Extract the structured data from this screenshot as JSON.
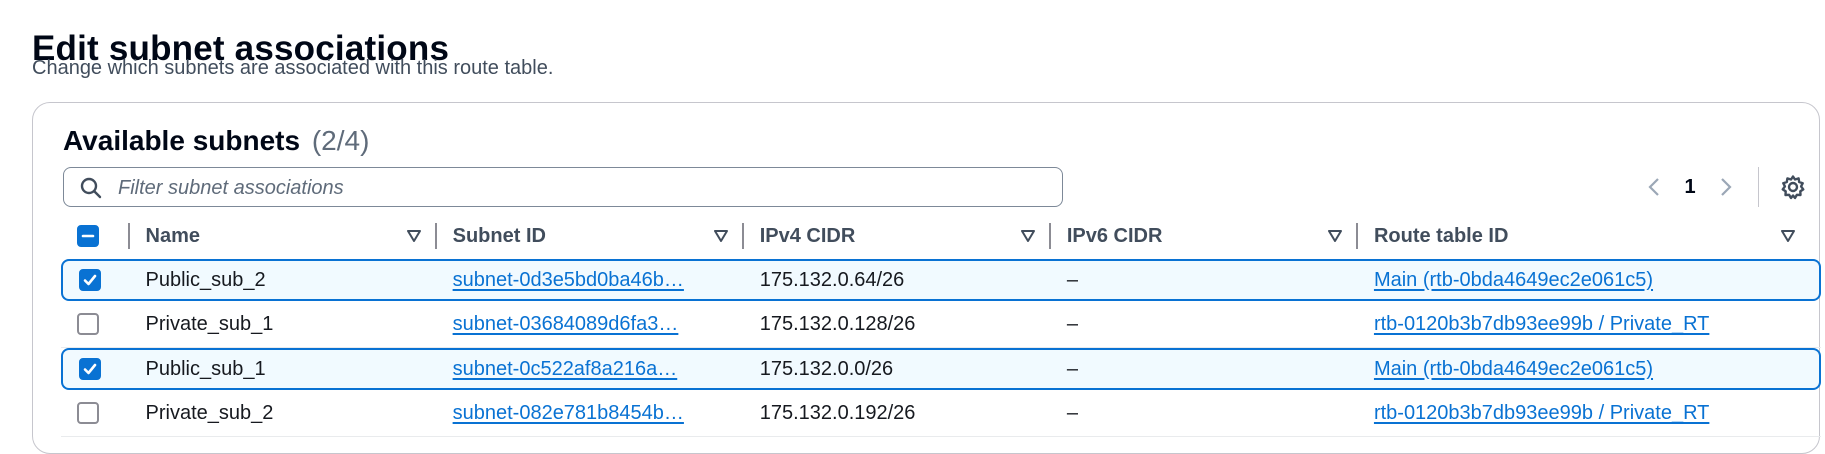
{
  "page": {
    "title": "Edit subnet associations",
    "description": "Change which subnets are associated with this route table."
  },
  "card": {
    "title": "Available subnets",
    "count": "(2/4)"
  },
  "filter": {
    "placeholder": "Filter subnet associations",
    "value": ""
  },
  "pagination": {
    "current_page": "1"
  },
  "icons": {
    "search": "search-icon",
    "prev": "chevron-left-icon",
    "next": "chevron-right-icon",
    "settings": "gear-icon",
    "sort": "caret-down-outline-icon"
  },
  "colors": {
    "link": "#0972d3",
    "selected_bg": "#f1faff",
    "checkbox": "#0972d3"
  },
  "table": {
    "select_all_state": "indeterminate",
    "columns": [
      "Name",
      "Subnet ID",
      "IPv4 CIDR",
      "IPv6 CIDR",
      "Route table ID"
    ],
    "rows": [
      {
        "selected": true,
        "name": "Public_sub_2",
        "subnet_id": "subnet-0d3e5bd0ba46b…",
        "ipv4": "175.132.0.64/26",
        "ipv6": "–",
        "route_table": "Main (rtb-0bda4649ec2e061c5)"
      },
      {
        "selected": false,
        "name": "Private_sub_1",
        "subnet_id": "subnet-03684089d6fa3…",
        "ipv4": "175.132.0.128/26",
        "ipv6": "–",
        "route_table": "rtb-0120b3b7db93ee99b / Private_RT"
      },
      {
        "selected": true,
        "name": "Public_sub_1",
        "subnet_id": "subnet-0c522af8a216a…",
        "ipv4": "175.132.0.0/26",
        "ipv6": "–",
        "route_table": "Main (rtb-0bda4649ec2e061c5)"
      },
      {
        "selected": false,
        "name": "Private_sub_2",
        "subnet_id": "subnet-082e781b8454b…",
        "ipv4": "175.132.0.192/26",
        "ipv6": "–",
        "route_table": "rtb-0120b3b7db93ee99b / Private_RT"
      }
    ]
  }
}
